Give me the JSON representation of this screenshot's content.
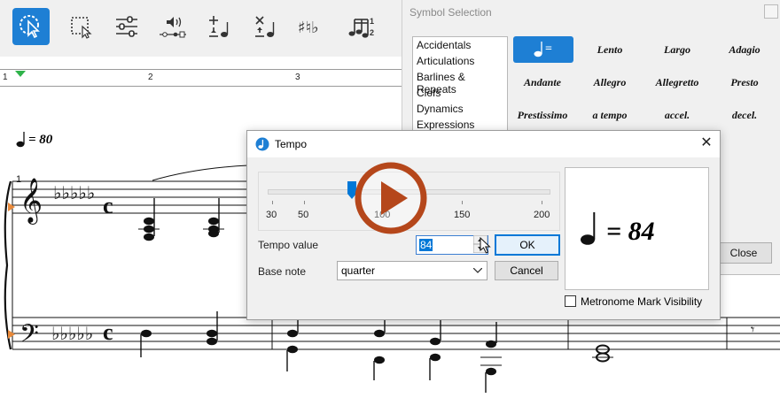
{
  "toolbar": {
    "tools": [
      {
        "icon": "select-cursor-icon",
        "active": true
      },
      {
        "icon": "rectangle-select-icon"
      },
      {
        "icon": "mixer-sliders-icon"
      },
      {
        "icon": "playback-icon"
      },
      {
        "icon": "add-note-icon"
      },
      {
        "icon": "delete-note-icon"
      },
      {
        "icon": "accidentals-icon"
      },
      {
        "icon": "tuplet-icon"
      }
    ],
    "accent": "#1e7fd4"
  },
  "ruler": {
    "measures": [
      "1",
      "2",
      "3"
    ]
  },
  "score": {
    "tempo_mark": "= 80",
    "measure_number": "1"
  },
  "symbol_selection": {
    "title": "Symbol Selection",
    "categories": [
      "Accidentals",
      "Articulations",
      "Barlines & Repeats",
      "Clefs",
      "Dynamics",
      "Expressions"
    ],
    "symbols": [
      "=",
      "Lento",
      "Largo",
      "Adagio",
      "Andante",
      "Allegro",
      "Allegretto",
      "Presto",
      "Prestissimo",
      "a tempo",
      "accel.",
      "decel."
    ],
    "close_label": "Close"
  },
  "tempo_dialog": {
    "title": "Tempo",
    "scale_labels": [
      "30",
      "50",
      "100",
      "150",
      "200"
    ],
    "slider_value": 84,
    "tempo_value_label": "Tempo value",
    "tempo_value": "84",
    "base_note_label": "Base note",
    "base_note": "quarter",
    "ok_label": "OK",
    "cancel_label": "Cancel",
    "preview": "= 84",
    "metronome_label": "Metronome Mark Visibility",
    "metronome_checked": false
  },
  "overlay": {
    "icon": "play-icon",
    "color": "#b5471b"
  }
}
